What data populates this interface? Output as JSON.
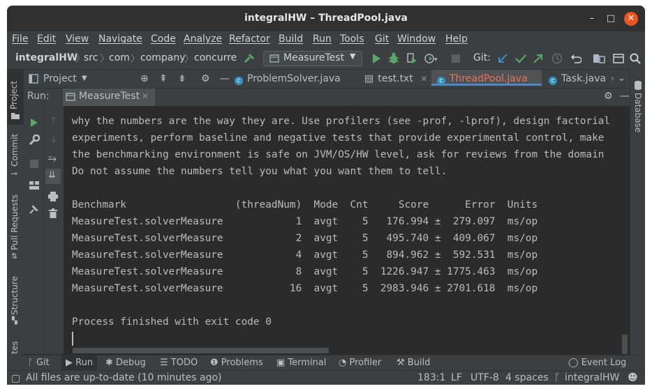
{
  "window": {
    "title": "integralHW – ThreadPool.java"
  },
  "menu": [
    "File",
    "Edit",
    "View",
    "Navigate",
    "Code",
    "Analyze",
    "Refactor",
    "Build",
    "Run",
    "Tools",
    "Git",
    "Window",
    "Help"
  ],
  "nav": {
    "crumbs": [
      "integralHW",
      "src",
      "com",
      "company",
      "concurre"
    ],
    "run_config": "MeasureTest",
    "git_label": "Git:"
  },
  "project_panel": {
    "label": "Project"
  },
  "tabs": [
    {
      "label": "ProblemSolver.java",
      "type": "class"
    },
    {
      "label": "test.txt",
      "type": "text"
    },
    {
      "label": "ThreadPool.java",
      "type": "class",
      "active": true
    },
    {
      "label": "Task.java",
      "type": "class"
    }
  ],
  "left_strip": [
    "Project",
    "Commit",
    "Pull Requests",
    "Structure",
    "ites"
  ],
  "right_strip": [
    "Database"
  ],
  "run": {
    "label": "Run:",
    "tab": "MeasureTest"
  },
  "console": {
    "lines": [
      "why the numbers are the way they are. Use profilers (see -prof, -lprof), design factorial",
      "experiments, perform baseline and negative tests that provide experimental control, make",
      "the benchmarking environment is safe on JVM/OS/HW level, ask for reviews from the domain",
      "Do not assume the numbers tell you what you want them to tell.",
      "",
      "Benchmark                  (threadNum)  Mode  Cnt     Score      Error  Units",
      "MeasureTest.solverMeasure            1  avgt    5   176.994 ±  279.097  ms/op",
      "MeasureTest.solverMeasure            2  avgt    5   495.740 ±  409.067  ms/op",
      "MeasureTest.solverMeasure            4  avgt    5   894.962 ±  592.531  ms/op",
      "MeasureTest.solverMeasure            8  avgt    5  1226.947 ± 1775.463  ms/op",
      "MeasureTest.solverMeasure           16  avgt    5  2983.946 ± 2701.618  ms/op",
      "",
      "Process finished with exit code 0"
    ]
  },
  "tool_windows": [
    "Git",
    "Run",
    "Debug",
    "TODO",
    "Problems",
    "Terminal",
    "Profiler",
    "Build",
    "Event Log"
  ],
  "status": {
    "message": "All files are up-to-date (10 minutes ago)",
    "position": "183:1",
    "line_sep": "LF",
    "encoding": "UTF-8",
    "indent": "4 spaces",
    "branch": "integralHW"
  },
  "colors": {
    "accent_active_tab": "#e9735a",
    "run_green": "#59a869",
    "class_icon": "#3592c4",
    "close_button": "#e95420"
  }
}
